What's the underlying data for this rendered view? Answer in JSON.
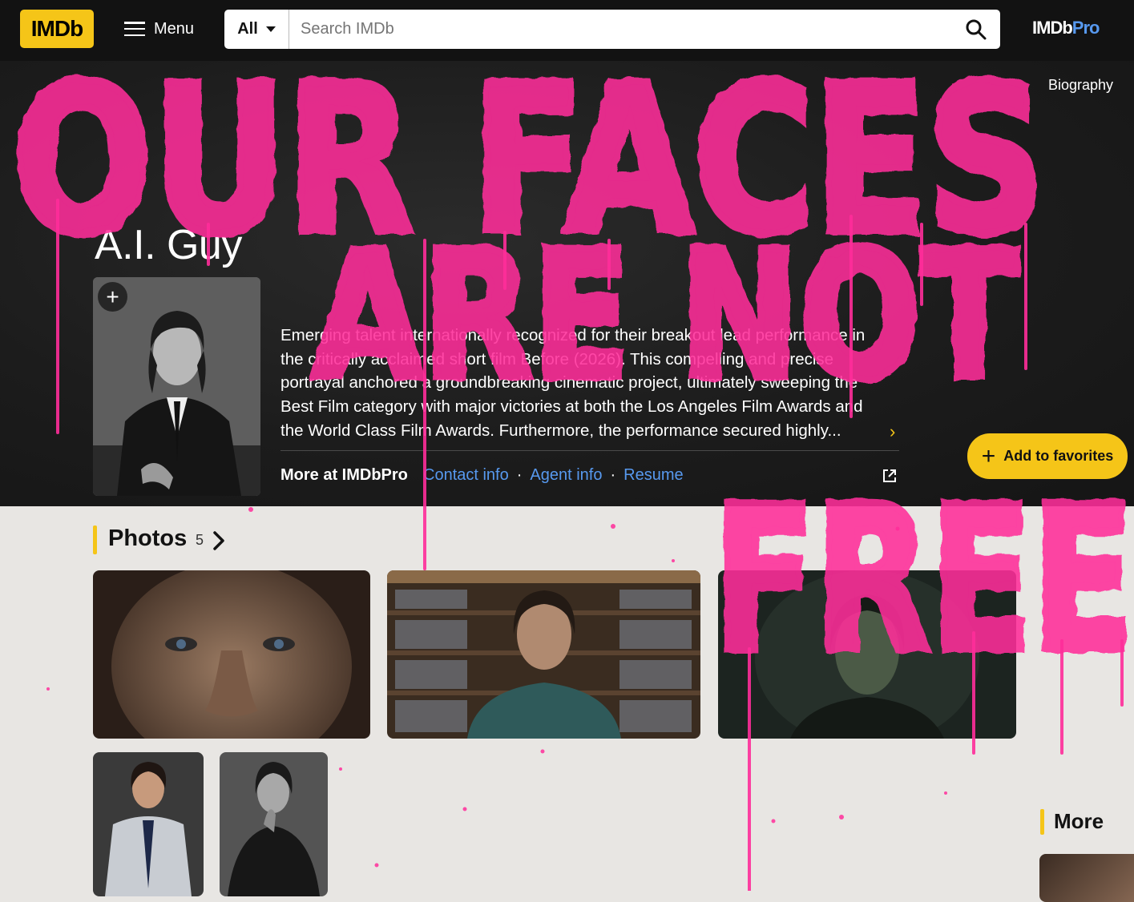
{
  "nav": {
    "logo": "IMDb",
    "menu_label": "Menu",
    "search_category": "All",
    "search_placeholder": "Search IMDb",
    "pro_logo_main": "IMDb",
    "pro_logo_accent": "Pro"
  },
  "hero": {
    "biography_link": "Biography",
    "name": "A.I. Guy",
    "bio": "Emerging talent internationally recognized for their breakout lead performance in the critically acclaimed short film Before (2026). This compelling and precise portrayal anchored a groundbreaking cinematic project, ultimately sweeping the Best Film category with major victories at both the Los Angeles Film Awards and the World Class Film Awards. Furthermore, the performance secured highly...",
    "more_at_pro": "More at IMDbPro",
    "links": [
      "Contact info",
      "Agent info",
      "Resume"
    ],
    "add_to_favorites": "Add to favorites"
  },
  "photos": {
    "title": "Photos",
    "count": "5"
  },
  "more": {
    "title": "More"
  },
  "overlay": {
    "graffiti_lines": [
      "OUR FACES",
      "ARE NOT",
      "FREE"
    ],
    "color": "#ff2d9a"
  },
  "colors": {
    "imdb_yellow": "#f5c518",
    "link_blue": "#5799ef",
    "topbar": "#121212"
  }
}
